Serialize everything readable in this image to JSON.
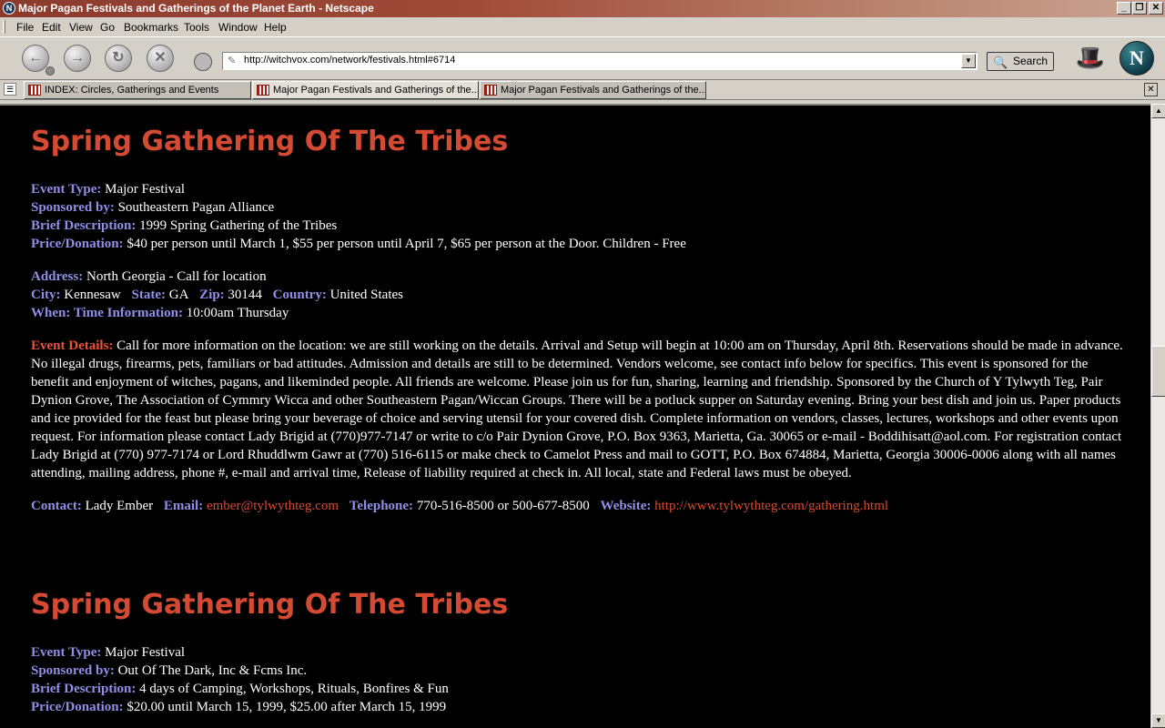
{
  "window": {
    "title": "Major Pagan Festivals and Gatherings of the Planet Earth - Netscape",
    "minimize": "_",
    "restore": "❐",
    "close": "✕"
  },
  "menu": [
    "File",
    "Edit",
    "View",
    "Go",
    "Bookmarks",
    "Tools",
    "Window",
    "Help"
  ],
  "toolbar": {
    "url": "http://witchvox.com/network/festivals.html#6714",
    "search_label": "Search"
  },
  "tabs": [
    {
      "label": "INDEX: Circles, Gatherings and Events"
    },
    {
      "label": "Major Pagan Festivals and Gatherings of the..."
    },
    {
      "label": "Major Pagan Festivals and Gatherings of the..."
    }
  ],
  "events": [
    {
      "title": "Spring Gathering Of The Tribes",
      "event_type_label": "Event Type:",
      "event_type": "Major Festival",
      "sponsored_label": "Sponsored by:",
      "sponsored": "Southeastern Pagan Alliance",
      "brief_label": "Brief Description:",
      "brief": "1999 Spring Gathering of the Tribes",
      "price_label": "Price/Donation:",
      "price": "$40 per person until March 1, $55 per person until April 7, $65 per person at the Door. Children - Free",
      "address_label": "Address:",
      "address": "North Georgia - Call for location",
      "city_label": "City:",
      "city": "Kennesaw",
      "state_label": "State:",
      "state": "GA",
      "zip_label": "Zip:",
      "zip": "30144",
      "country_label": "Country:",
      "country": "United States",
      "when_label": "When: Time Information:",
      "when": "10:00am Thursday",
      "details_label": "Event Details:",
      "details": "Call for more information on the location: we are still working on the details. Arrival and Setup will begin at 10:00 am on Thursday, April 8th. Reservations should be made in advance. No illegal drugs, firearms, pets, familiars or bad attitudes. Admission and details are still to be determined. Vendors welcome, see contact info below for specifics. This event is sponsored for the benefit and enjoyment of witches, pagans, and likeminded people. All friends are welcome. Please join us for fun, sharing, learning and friendship. Sponsored by the Church of Y Tylwyth Teg, Pair Dynion Grove, The Association of Cymmry Wicca and other Southeastern Pagan/Wiccan Groups. There will be a potluck supper on Saturday evening. Bring your best dish and join us. Paper products and ice provided for the feast but please bring your beverage of choice and serving utensil for your covered dish. Complete information on vendors, classes, lectures, workshops and other events upon request. For information please contact Lady Brigid at (770)977-7147 or write to c/o Pair Dynion Grove, P.O. Box 9363, Marietta, Ga. 30065 or e-mail - Boddihisatt@aol.com. For registration contact Lady Brigid at (770) 977-7174 or Lord Rhuddlwm Gawr at (770) 516-6115 or make check to Camelot Press and mail to GOTT, P.O. Box 674884, Marietta, Georgia 30006-0006 along with all names attending, mailing address, phone #, e-mail and arrival time, Release of liability required at check in. All local, state and Federal laws must be obeyed.",
      "contact_label": "Contact:",
      "contact": "Lady Ember",
      "email_label": "Email:",
      "email": "ember@tylwythteg.com",
      "phone_label": "Telephone:",
      "phone": "770-516-8500 or 500-677-8500",
      "website_label": "Website:",
      "website": "http://www.tylwythteg.com/gathering.html"
    },
    {
      "title": "Spring Gathering Of The Tribes",
      "event_type_label": "Event Type:",
      "event_type": "Major Festival",
      "sponsored_label": "Sponsored by:",
      "sponsored": "Out Of The Dark, Inc & Fcms Inc.",
      "brief_label": "Brief Description:",
      "brief": "4 days of Camping, Workshops, Rituals, Bonfires & Fun",
      "price_label": "Price/Donation:",
      "price": "$20.00 until March 15, 1999, $25.00 after March 15, 1999"
    }
  ]
}
